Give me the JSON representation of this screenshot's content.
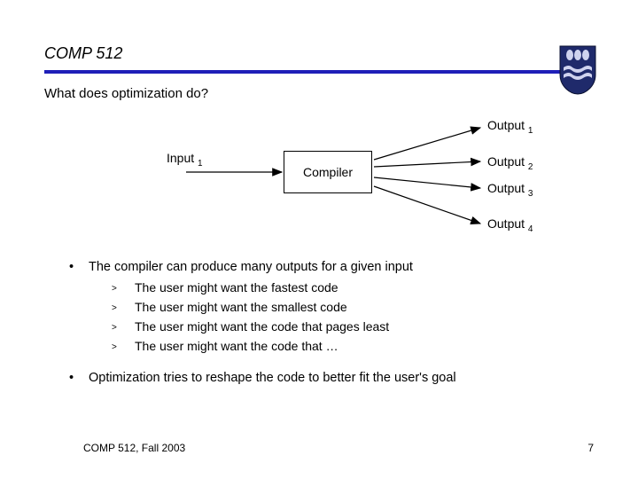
{
  "header": {
    "course": "COMP 512",
    "subtitle": "What does optimization do?"
  },
  "diagram": {
    "input": "Input",
    "input_sub": "1",
    "compiler": "Compiler",
    "output_word": "Output",
    "outputs": [
      "1",
      "2",
      "3",
      "4"
    ]
  },
  "bullets": [
    {
      "text": "The compiler can produce many outputs for a given input",
      "subs": [
        "The user might want the fastest code",
        "The user might want the smallest code",
        "The user might want the code that pages least",
        "The user might want the code that …"
      ]
    },
    {
      "text": "Optimization tries to reshape the code to better fit the user's goal",
      "subs": []
    }
  ],
  "footer": {
    "left": "COMP 512, Fall 2003",
    "page": "7"
  }
}
